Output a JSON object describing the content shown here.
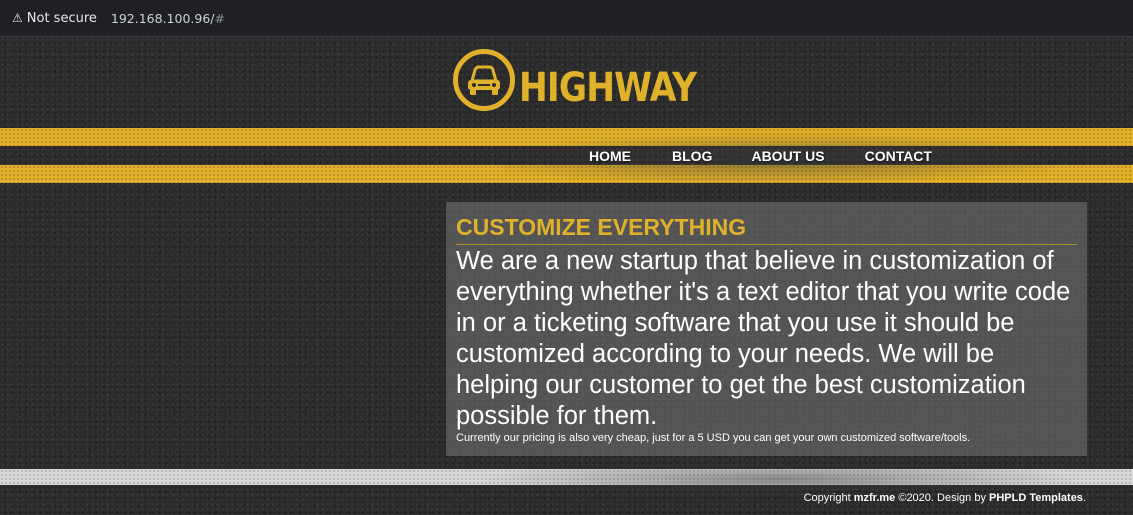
{
  "browser": {
    "security_label": "Not secure",
    "url_host": "192.168.100.96/",
    "url_hash": "#"
  },
  "logo": {
    "text": "HIGHWAY",
    "icon": "car-icon",
    "color": "#e0b22b"
  },
  "nav": {
    "items": [
      {
        "label": "HOME"
      },
      {
        "label": "BLOG"
      },
      {
        "label": "ABOUT US"
      },
      {
        "label": "CONTACT"
      }
    ]
  },
  "main": {
    "heading": "CUSTOMIZE EVERYTHING",
    "lead": "We are a new startup that believe in customization of everything whether it's a text editor that you write code in or a ticketing software that you use it should be customized according to your needs. We will be helping our customer to get the best customization possible for them.",
    "note": "Currently our pricing is also very cheap, just for a 5 USD you can get your own customized software/tools."
  },
  "footer": {
    "prefix": "Copyright ",
    "site": "mzfr.me",
    "middle": " ©2020. Design by ",
    "designer": "PHPLD Templates",
    "suffix": "."
  }
}
